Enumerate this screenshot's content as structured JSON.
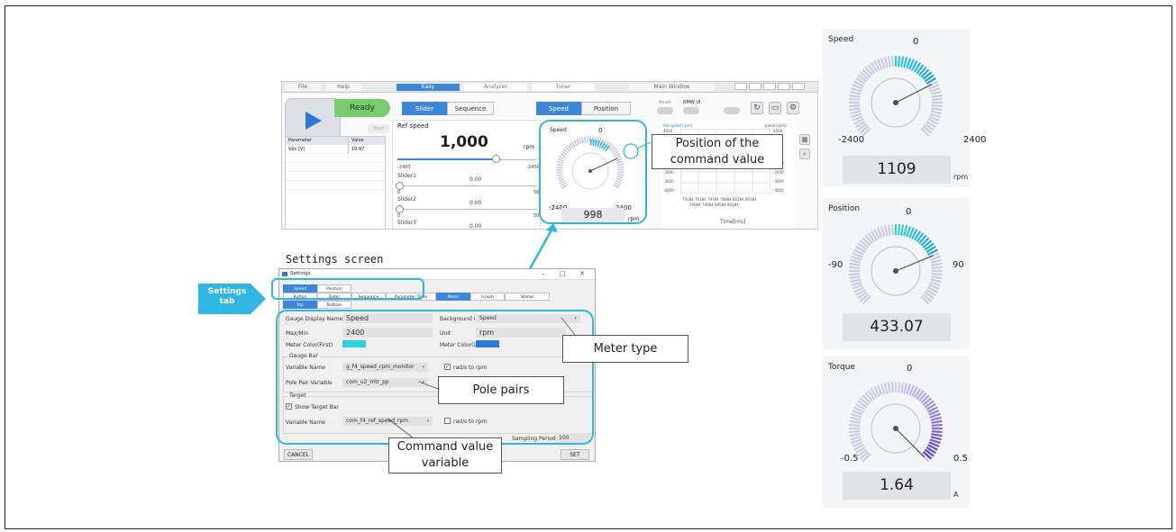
{
  "app": {
    "menu": {
      "file": "File",
      "help": "Help",
      "modes": [
        "Easy",
        "Analyzer",
        "Tuner"
      ],
      "active_mode": "Easy",
      "main_window": "Main Window"
    },
    "status": "Ready",
    "start_label": "Start",
    "param_table": {
      "headers": [
        "Parameter",
        "Value"
      ],
      "rows": [
        [
          "Vdc [V]",
          "10.97"
        ]
      ]
    },
    "mode_tabs": [
      "Slider",
      "Sequence"
    ],
    "control_tabs": [
      "Speed",
      "Position"
    ],
    "toggles": {
      "reset": "Reset",
      "rmw_ui": "RMW UI"
    },
    "ref_speed": {
      "label": "Ref speed",
      "value": "1,000",
      "unit": "rpm",
      "min": "-2400",
      "max": "2400",
      "sliders": [
        {
          "name": "Slider1",
          "value": "0.00",
          "min": "0",
          "max": "50"
        },
        {
          "name": "Slider2",
          "value": "0.00",
          "min": "0",
          "max": "50"
        },
        {
          "name": "Slider3",
          "value": "0.00"
        }
      ]
    },
    "mini_gauge": {
      "title": "Speed",
      "zero": "0",
      "min": "-2400",
      "max": "2400",
      "value": "998",
      "unit": "rpm"
    },
    "graph": {
      "legend_left": "Ref speed [rpm]",
      "legend_right": "speed [rpm]",
      "y_left": [
        "4000",
        "3000",
        "-1000",
        "-2000",
        "-3000",
        "-4000"
      ],
      "y_right": [
        "4000",
        "3000",
        "-1000",
        "-2000",
        "-3000",
        "-4000"
      ],
      "x_row1": "79284   79384   79784   79984   80184   80384",
      "x_row2": "79684   79884   80084   80284",
      "x_label": "Time[ms]"
    }
  },
  "callouts": {
    "command_position": "Position of the command value",
    "settings_screen": "Settings screen",
    "settings_tab": "Settings tab",
    "meter_type": "Meter type",
    "pole_pairs": "Pole pairs",
    "command_variable": "Command value variable"
  },
  "settings": {
    "title": "Settings",
    "window_controls": [
      "–",
      "□",
      "✕"
    ],
    "tabs_row1": [
      "Speed",
      "Position"
    ],
    "tabs_row2": [
      "Button",
      "Slider",
      "Sequence",
      "Parameter Table",
      "Meter",
      "Graph",
      "Status"
    ],
    "tabs_row3": [
      "Top",
      "Bottom"
    ],
    "gauge_display_name_label": "Gauge Display Name",
    "gauge_display_name": "Speed",
    "background_image_label": "Background Image",
    "background_image": "Speed",
    "max_min_label": "Max/Min",
    "max_min": "2400",
    "unit_label": "Unit",
    "unit": "rpm",
    "meter_color_first_label": "Meter Color(First)",
    "meter_color_first": "#30d0e0",
    "meter_color_last_label": "Meter Color(Last)",
    "meter_color_last": "#2a7ad6",
    "gauge_bar_label": "Gauge Bar",
    "variable_name_label": "Variable Name",
    "gauge_variable": "g_f4_speed_rpm_monitor",
    "rad_to_rpm": "rad/s to rpm",
    "pole_pair_label": "Pole Pair Variable",
    "pole_pair_variable": "com_u2_mtr_pp",
    "target_label": "Target",
    "show_target_bar": "Show Target Bar",
    "target_variable_label": "Variable Name",
    "target_variable": "com_f4_ref_speed_rpm",
    "sampling_label": "Sampling Period",
    "sampling_value": "100",
    "cancel": "CANCEL",
    "set": "SET"
  },
  "gauges": [
    {
      "title": "Speed",
      "zero": "0",
      "min": "-2400",
      "max": "2400",
      "value": "1109",
      "unit": "rpm",
      "fill_fraction": 0.23,
      "color_start": "#30d0e0",
      "color_end": "#2a9fd6"
    },
    {
      "title": "Position",
      "zero": "0",
      "min": "-90",
      "max": "90",
      "value": "433.07",
      "unit": "",
      "fill_fraction": 0.25,
      "color_start": "#30d0e0",
      "color_end": "#2a9fd6"
    },
    {
      "title": "Torque",
      "zero": "0",
      "min": "-0.5",
      "max": "0.5",
      "value": "1.64",
      "unit": "A",
      "fill_fraction": 0.5,
      "color_start": "#d9cff5",
      "color_end": "#5a3fc8"
    }
  ]
}
